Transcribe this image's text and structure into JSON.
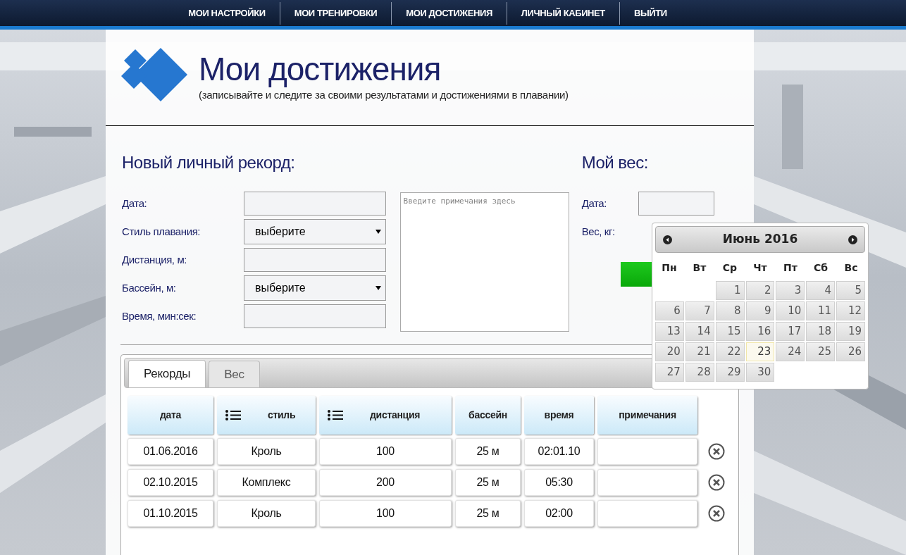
{
  "nav": [
    "МОИ НАСТРОЙКИ",
    "МОИ ТРЕНИРОВКИ",
    "МОИ ДОСТИЖЕНИЯ",
    "ЛИЧНЫЙ КАБИНЕТ",
    "ВЫЙТИ"
  ],
  "header": {
    "title": "Мои достижения",
    "subtitle": "(записывайте и следите за своими результатами и достижениями в плавании)"
  },
  "record_form": {
    "title": "Новый личный рекорд:",
    "fields": [
      {
        "label": "Дата:",
        "kind": "text"
      },
      {
        "label": "Стиль плавания:",
        "kind": "select",
        "value": "выберите"
      },
      {
        "label": "Дистанция, м:",
        "kind": "text"
      },
      {
        "label": "Бассейн, м:",
        "kind": "select",
        "value": "выберите"
      },
      {
        "label": "Время, мин:сек:",
        "kind": "text"
      }
    ],
    "notes": {
      "placeholder": "Введите примечания здесь"
    }
  },
  "weight_form": {
    "title": "Мой вес:",
    "fields": [
      {
        "label": "Дата:",
        "kind": "text"
      },
      {
        "label": "Вес, кг:",
        "kind": "label"
      }
    ]
  },
  "calendar": {
    "title": "Июнь 2016",
    "weekdays": [
      "Пн",
      "Вт",
      "Ср",
      "Чт",
      "Пт",
      "Сб",
      "Вс"
    ],
    "weeks": [
      [
        {
          "kind": "empty"
        },
        {
          "kind": "empty"
        },
        {
          "day": "1",
          "today": false
        },
        {
          "day": "2",
          "today": false
        },
        {
          "day": "3",
          "today": false
        },
        {
          "day": "4",
          "today": false
        },
        {
          "day": "5",
          "today": false
        }
      ],
      [
        {
          "day": "6",
          "today": false
        },
        {
          "day": "7",
          "today": false
        },
        {
          "day": "8",
          "today": false
        },
        {
          "day": "9",
          "today": false
        },
        {
          "day": "10",
          "today": false
        },
        {
          "day": "11",
          "today": false
        },
        {
          "day": "12",
          "today": false
        }
      ],
      [
        {
          "day": "13",
          "today": false
        },
        {
          "day": "14",
          "today": false
        },
        {
          "day": "15",
          "today": false
        },
        {
          "day": "16",
          "today": false
        },
        {
          "day": "17",
          "today": false
        },
        {
          "day": "18",
          "today": false
        },
        {
          "day": "19",
          "today": false
        }
      ],
      [
        {
          "day": "20",
          "today": false
        },
        {
          "day": "21",
          "today": false
        },
        {
          "day": "22",
          "today": false
        },
        {
          "day": "23",
          "today": true
        },
        {
          "day": "24",
          "today": false
        },
        {
          "day": "25",
          "today": false
        },
        {
          "day": "26",
          "today": false
        }
      ],
      [
        {
          "day": "27",
          "today": false
        },
        {
          "day": "28",
          "today": false
        },
        {
          "day": "29",
          "today": false
        },
        {
          "day": "30",
          "today": false
        }
      ]
    ]
  },
  "tabs": [
    {
      "label": "Рекорды",
      "selected": true
    },
    {
      "label": "Вес",
      "selected": false
    }
  ],
  "table": {
    "columns": [
      {
        "label": "дата",
        "list_icon": false
      },
      {
        "label": "стиль",
        "list_icon": true
      },
      {
        "label": "дистанция",
        "list_icon": true
      },
      {
        "label": "бассейн",
        "list_icon": false
      },
      {
        "label": "время",
        "list_icon": false
      },
      {
        "label": "примечания",
        "list_icon": false
      }
    ],
    "rows": [
      {
        "cells": [
          "01.06.2016",
          "Кроль",
          "100",
          "25 м",
          "02:01.10"
        ]
      },
      {
        "cells": [
          "02.10.2015",
          "Комплекс",
          "200",
          "25 м",
          "05:30"
        ]
      },
      {
        "cells": [
          "01.10.2015",
          "Кроль",
          "100",
          "25 м",
          "02:00"
        ]
      }
    ]
  }
}
